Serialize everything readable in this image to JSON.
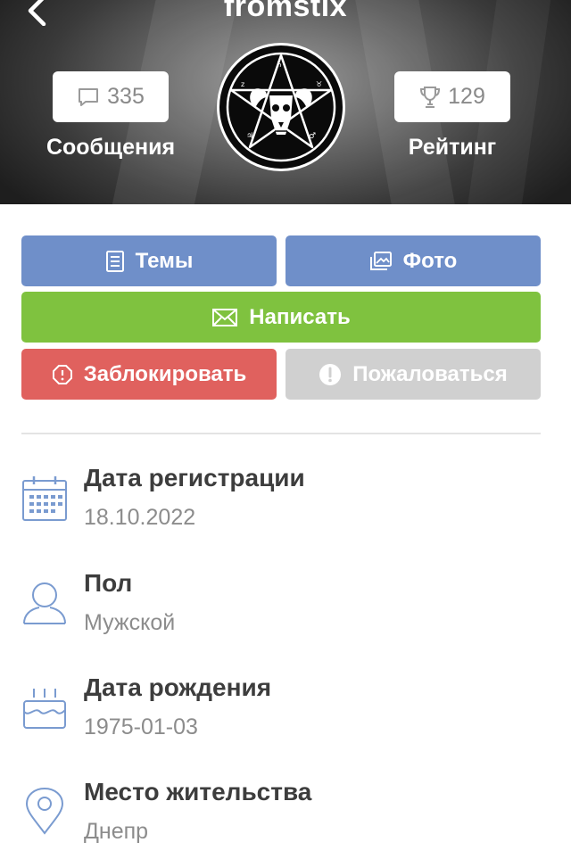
{
  "header": {
    "username": "fromstix",
    "messages": {
      "count": "335",
      "label": "Сообщения",
      "icon": "speech-bubble-icon"
    },
    "rating": {
      "count": "129",
      "label": "Рейтинг",
      "icon": "trophy-icon"
    }
  },
  "actions": {
    "topics": "Темы",
    "photo": "Фото",
    "write": "Написать",
    "block": "Заблокировать",
    "report": "Пожаловаться"
  },
  "colors": {
    "blue": "#6f8fc9",
    "green": "#7fc23f",
    "red": "#e0615e",
    "grey": "#d0d0d0",
    "info_icon": "#7a9bd0"
  },
  "info": {
    "registration": {
      "title": "Дата регистрации",
      "value": "18.10.2022",
      "icon": "calendar-icon"
    },
    "gender": {
      "title": "Пол",
      "value": "Мужской",
      "icon": "person-icon"
    },
    "birthday": {
      "title": "Дата рождения",
      "value": "1975-01-03",
      "icon": "birthday-cake-icon"
    },
    "location": {
      "title": "Место жительства",
      "value": "Днепр",
      "icon": "location-pin-icon"
    }
  }
}
